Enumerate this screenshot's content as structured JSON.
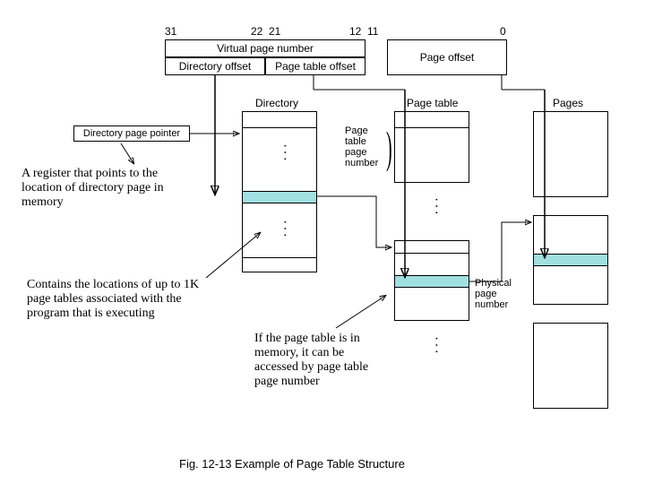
{
  "bits": {
    "b31": "31",
    "b22": "22",
    "b21": "21",
    "b12": "12",
    "b11": "11",
    "b0": "0"
  },
  "vpn": "Virtual page number",
  "dir_off": "Directory offset",
  "pt_off": "Page table offset",
  "pg_off": "Page offset",
  "col": {
    "dir": "Directory",
    "pt": "Page table",
    "pg": "Pages"
  },
  "dpp": "Directory page pointer",
  "ptpn": "Page\ntable\npage\nnumber",
  "ppn": "Physical\npage\nnumber",
  "ann1": "A register that points to the location of directory page in memory",
  "ann2": "Contains the locations of up to 1K page tables associated with the program that is executing",
  "ann3": "If the page table is in memory, it can be accessed by page table page number",
  "caption": "Fig. 12-13  Example of Page Table Structure"
}
